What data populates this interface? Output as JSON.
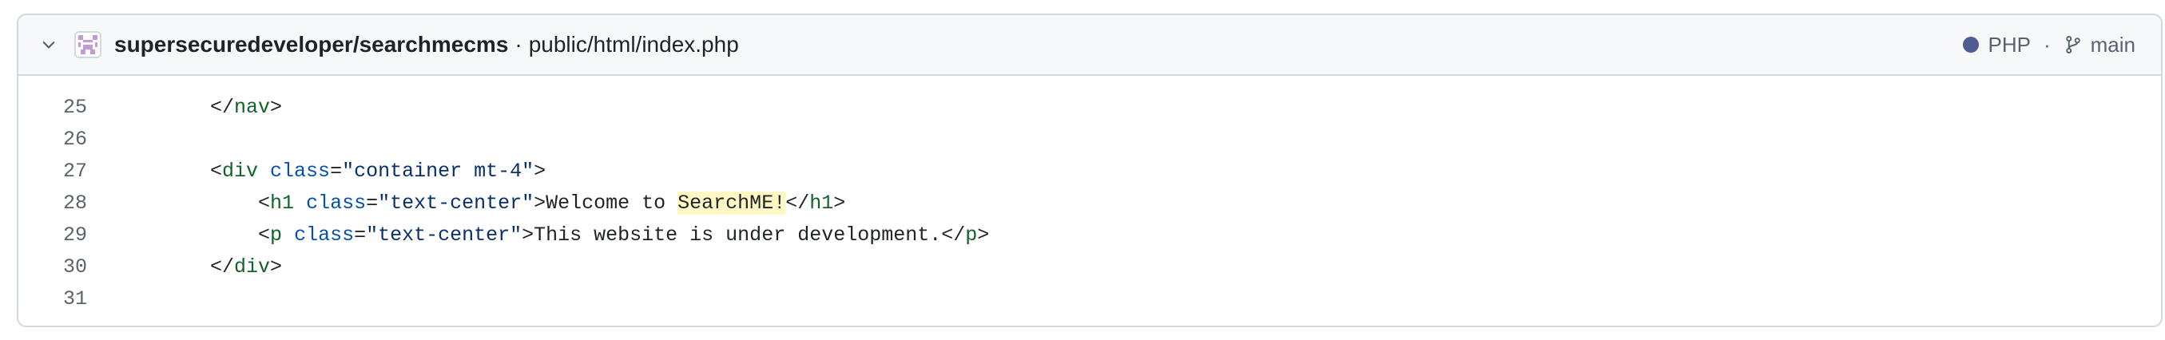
{
  "header": {
    "repo": "supersecuredeveloper/searchmecms",
    "separator": "·",
    "path": "public/html/index.php",
    "language": "PHP",
    "language_color": "#4F5D95",
    "meta_separator": "·",
    "branch": "main",
    "icons": {
      "collapse": "chevron-down-icon",
      "avatar": "identicon-avatar",
      "branch": "git-branch-icon"
    }
  },
  "code": {
    "highlight_color": "#fff8c5",
    "lines": [
      {
        "number": "25",
        "tokens": [
          {
            "t": "    </",
            "c": "plain"
          },
          {
            "t": "nav",
            "c": "tag"
          },
          {
            "t": ">",
            "c": "plain"
          }
        ]
      },
      {
        "number": "26",
        "tokens": []
      },
      {
        "number": "27",
        "tokens": [
          {
            "t": "    <",
            "c": "plain"
          },
          {
            "t": "div",
            "c": "tag"
          },
          {
            "t": " ",
            "c": "plain"
          },
          {
            "t": "class",
            "c": "attr"
          },
          {
            "t": "=",
            "c": "plain"
          },
          {
            "t": "\"container mt-4\"",
            "c": "str"
          },
          {
            "t": ">",
            "c": "plain"
          }
        ]
      },
      {
        "number": "28",
        "tokens": [
          {
            "t": "        <",
            "c": "plain"
          },
          {
            "t": "h1",
            "c": "tag"
          },
          {
            "t": " ",
            "c": "plain"
          },
          {
            "t": "class",
            "c": "attr"
          },
          {
            "t": "=",
            "c": "plain"
          },
          {
            "t": "\"text-center\"",
            "c": "str"
          },
          {
            "t": ">Welcome to ",
            "c": "plain"
          },
          {
            "t": "SearchME!",
            "c": "hl"
          },
          {
            "t": "</",
            "c": "plain"
          },
          {
            "t": "h1",
            "c": "tag"
          },
          {
            "t": ">",
            "c": "plain"
          }
        ]
      },
      {
        "number": "29",
        "tokens": [
          {
            "t": "        <",
            "c": "plain"
          },
          {
            "t": "p",
            "c": "tag"
          },
          {
            "t": " ",
            "c": "plain"
          },
          {
            "t": "class",
            "c": "attr"
          },
          {
            "t": "=",
            "c": "plain"
          },
          {
            "t": "\"text-center\"",
            "c": "str"
          },
          {
            "t": ">This website is under development.</",
            "c": "plain"
          },
          {
            "t": "p",
            "c": "tag"
          },
          {
            "t": ">",
            "c": "plain"
          }
        ]
      },
      {
        "number": "30",
        "tokens": [
          {
            "t": "    </",
            "c": "plain"
          },
          {
            "t": "div",
            "c": "tag"
          },
          {
            "t": ">",
            "c": "plain"
          }
        ]
      },
      {
        "number": "31",
        "tokens": []
      }
    ]
  }
}
